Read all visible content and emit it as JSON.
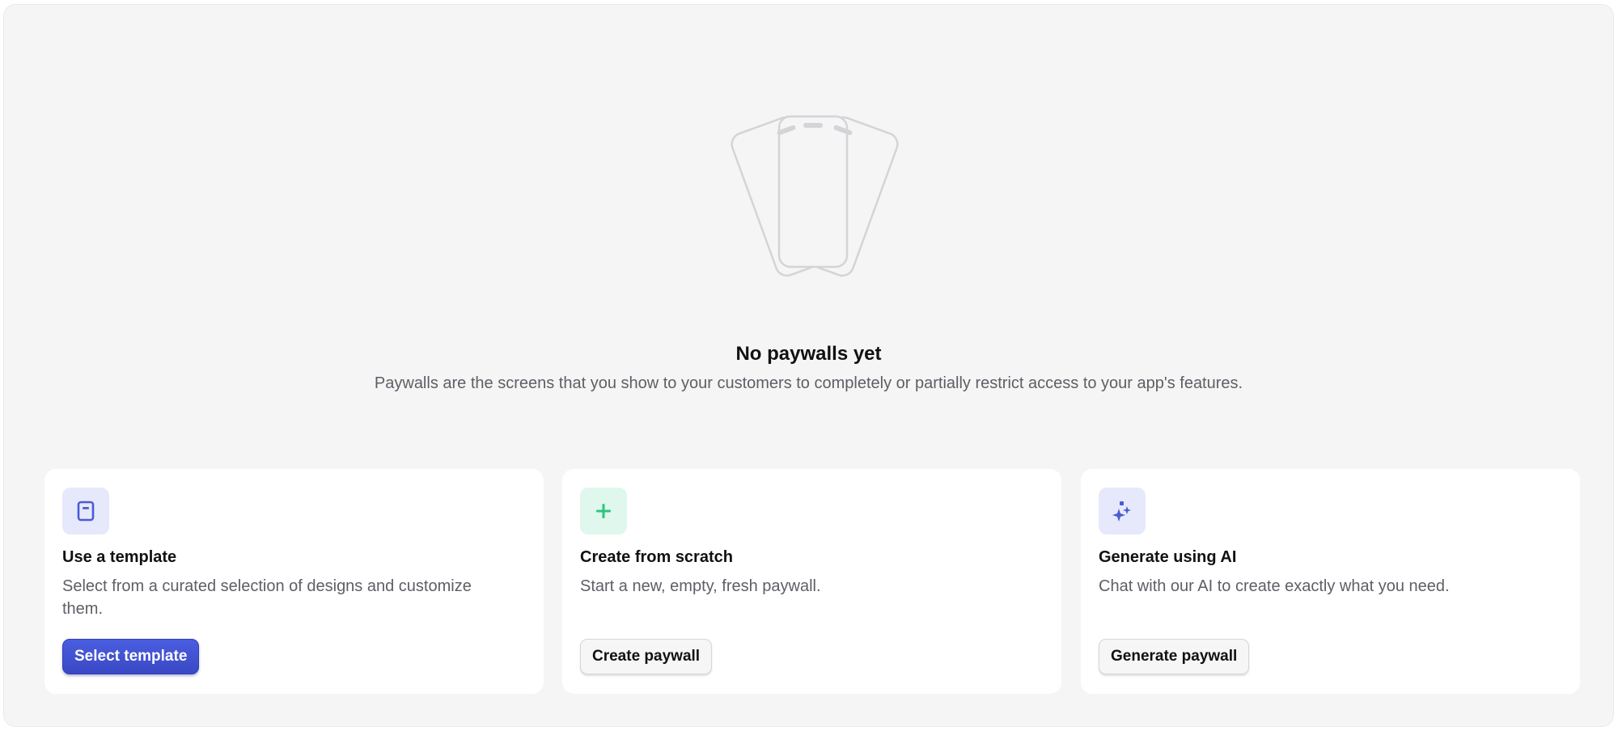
{
  "empty_state": {
    "illustration_icon": "phones-illustration",
    "title": "No paywalls yet",
    "description": "Paywalls are the screens that you show to your customers to completely or partially restrict access to your app's features."
  },
  "cards": [
    {
      "icon": "template-icon",
      "icon_color": "#4a5bd4",
      "icon_bg": "#e6e9fb",
      "title": "Use a template",
      "description": "Select from a curated selection of designs and customize them.",
      "button_label": "Select template"
    },
    {
      "icon": "plus-icon",
      "icon_color": "#2fc47f",
      "icon_bg": "#dff7ec",
      "title": "Create from scratch",
      "description": "Start a new, empty, fresh paywall.",
      "button_label": "Create paywall"
    },
    {
      "icon": "sparkles-icon",
      "icon_color": "#4a5bd4",
      "icon_bg": "#e6e9fb",
      "title": "Generate using AI",
      "description": "Chat with our AI to create exactly what you need.",
      "button_label": "Generate paywall"
    }
  ],
  "colors": {
    "accent": "#3f50d0",
    "panel_bg": "#f5f5f5"
  }
}
